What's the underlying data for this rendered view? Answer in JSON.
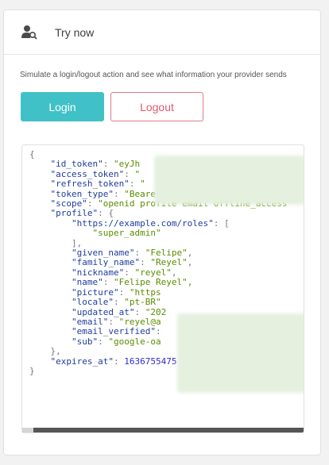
{
  "header": {
    "title": "Try now",
    "icon": "user-search-icon"
  },
  "description": "Simulate a login/logout action and see what information your provider sends",
  "buttons": {
    "login": "Login",
    "logout": "Logout"
  },
  "colors": {
    "accent": "#40c1c7",
    "danger": "#e05a6b"
  },
  "response": {
    "brace_open": "{",
    "id_token": {
      "key": "\"id_token\"",
      "value": "\"eyJh"
    },
    "access_token": {
      "key": "\"access_token\"",
      "value": "\""
    },
    "refresh_token": {
      "key": "\"refresh_token\"",
      "value": "\""
    },
    "token_type": {
      "key": "\"token_type\"",
      "value": "\"Bearer\","
    },
    "scope": {
      "key": "\"scope\"",
      "value": "\"openid profile email offline_access\""
    },
    "profile": {
      "key": "\"profile\"",
      "roles_key": "\"https://example.com/roles\"",
      "roles_value": "\"super_admin\"",
      "given_name": {
        "key": "\"given_name\"",
        "value": "\"Felipe\""
      },
      "family_name": {
        "key": "\"family_name\"",
        "value": "\"Reyel\""
      },
      "nickname": {
        "key": "\"nickname\"",
        "value": "\"reyel\""
      },
      "name": {
        "key": "\"name\"",
        "value": "\"Felipe Reyel\","
      },
      "picture": {
        "key": "\"picture\"",
        "value": "\"https"
      },
      "locale": {
        "key": "\"locale\"",
        "value": "\"pt-BR\""
      },
      "updated_at": {
        "key": "\"updated_at\"",
        "value": "\"202"
      },
      "email": {
        "key": "\"email\"",
        "value": "\"reyel@a"
      },
      "email_verified": {
        "key": "\"email_verified\"",
        "value": ""
      },
      "sub": {
        "key": "\"sub\"",
        "value": "\"google-oa"
      }
    },
    "expires_at": {
      "key": "\"expires_at\"",
      "value": "1636755475"
    },
    "brace_close": "}"
  }
}
